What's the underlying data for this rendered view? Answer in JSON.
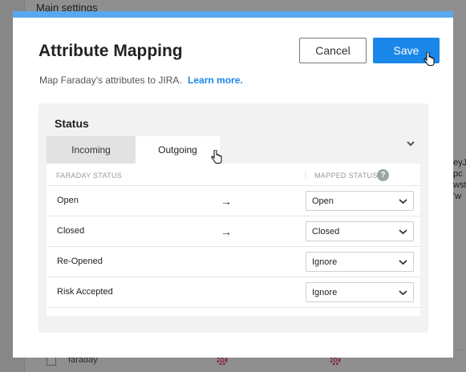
{
  "background": {
    "section_title": "Main settings",
    "right_text_lines": [
      "eyJ",
      "pc",
      "wst",
      "'w"
    ],
    "row_label": "faraday"
  },
  "modal": {
    "title": "Attribute Mapping",
    "subtitle": "Map Faraday's attributes to JIRA.",
    "learn_more": "Learn more.",
    "cancel_label": "Cancel",
    "save_label": "Save",
    "accent_color": "#1a86e8",
    "header_bar_color": "#58a8f0"
  },
  "status_panel": {
    "heading": "Status",
    "tabs": [
      {
        "label": "Incoming",
        "active": false
      },
      {
        "label": "Outgoing",
        "active": true
      }
    ],
    "columns": {
      "left": "FARADAY STATUS",
      "right": "MAPPED STATUS"
    },
    "rows": [
      {
        "status": "Open",
        "arrow": "→",
        "mapped": "Open"
      },
      {
        "status": "Closed",
        "arrow": "→",
        "mapped": "Closed"
      },
      {
        "status": "Re-Opened",
        "arrow": "",
        "mapped": "Ignore"
      },
      {
        "status": "Risk Accepted",
        "arrow": "",
        "mapped": "Ignore"
      }
    ]
  }
}
